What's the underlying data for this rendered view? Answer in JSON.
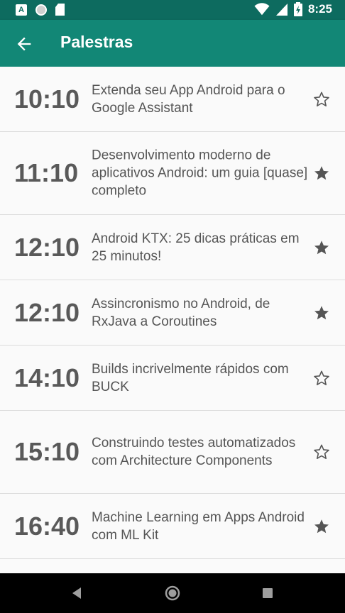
{
  "status": {
    "time": "8:25"
  },
  "appbar": {
    "title": "Palestras"
  },
  "talks": [
    {
      "time": "10:10",
      "title": "Extenda seu App Android para o Google Assistant",
      "starred": false
    },
    {
      "time": "11:10",
      "title": "Desenvolvimento moderno de aplicativos Android: um guia [quase] completo",
      "starred": true
    },
    {
      "time": "12:10",
      "title": "Android KTX: 25 dicas práticas em 25 minutos!",
      "starred": true
    },
    {
      "time": "12:10",
      "title": "Assincronismo no Android, de RxJava a Coroutines",
      "starred": true
    },
    {
      "time": "14:10",
      "title": "Builds incrivelmente rápidos com BUCK",
      "starred": false
    },
    {
      "time": "15:10",
      "title": "Construindo testes automatizados com Architecture Components",
      "starred": false
    },
    {
      "time": "16:40",
      "title": "Machine Learning em Apps Android com ML Kit",
      "starred": true
    }
  ],
  "icons": {
    "back": "arrow-back-icon",
    "star_filled": "star-filled-icon",
    "star_outline": "star-outline-icon"
  },
  "colors": {
    "statusbar": "#0d6b5f",
    "appbar": "#128776",
    "text_time": "#595959",
    "text_title": "#555555"
  }
}
